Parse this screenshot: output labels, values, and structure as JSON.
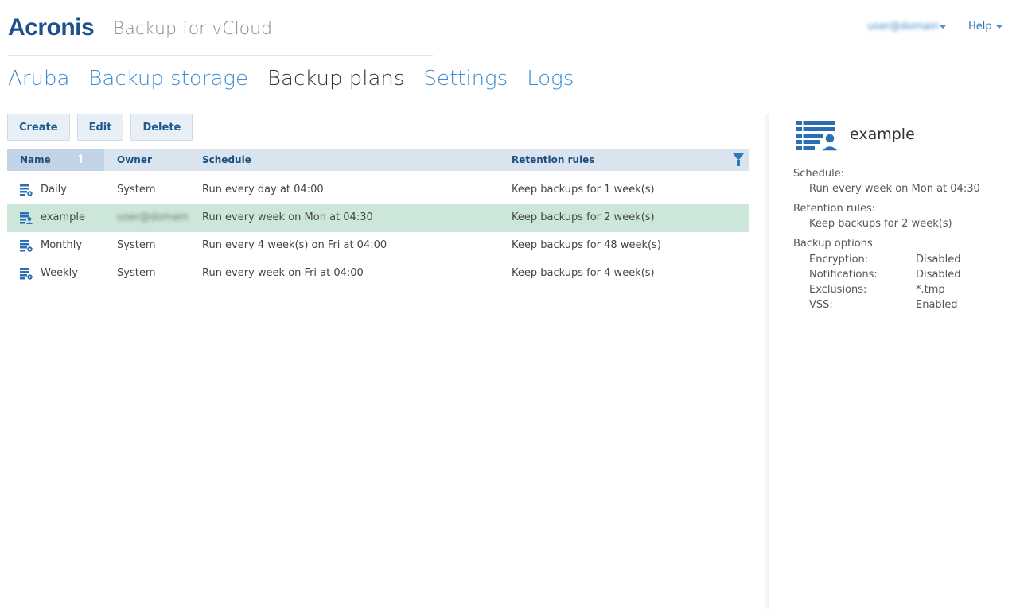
{
  "brand": {
    "logo": "Acronis",
    "product": "Backup for vCloud"
  },
  "header": {
    "user": "user@domain",
    "help": "Help"
  },
  "nav": {
    "items": [
      "Aruba",
      "Backup storage",
      "Backup plans",
      "Settings",
      "Logs"
    ],
    "active": "Backup plans"
  },
  "toolbar": {
    "create": "Create",
    "edit": "Edit",
    "delete": "Delete"
  },
  "grid": {
    "columns": {
      "name": "Name",
      "owner": "Owner",
      "schedule": "Schedule",
      "retention": "Retention rules"
    },
    "rows": [
      {
        "name": "Daily",
        "owner": "System",
        "schedule": "Run every day at 04:00",
        "retention": "Keep backups for 1 week(s)"
      },
      {
        "name": "example",
        "owner": "user@domain",
        "schedule": "Run every week on Mon at 04:30",
        "retention": "Keep backups for 2 week(s)"
      },
      {
        "name": "Monthly",
        "owner": "System",
        "schedule": "Run every 4 week(s) on Fri at 04:00",
        "retention": "Keep backups for 48 week(s)"
      },
      {
        "name": "Weekly",
        "owner": "System",
        "schedule": "Run every week on Fri at 04:00",
        "retention": "Keep backups for 4 week(s)"
      }
    ]
  },
  "detail": {
    "title": "example",
    "schedule_label": "Schedule:",
    "schedule_value": "Run every week on Mon at 04:30",
    "retention_label": "Retention rules:",
    "retention_value": "Keep backups for 2 week(s)",
    "options_label": "Backup options",
    "options": [
      {
        "key": "Encryption:",
        "value": "Disabled"
      },
      {
        "key": "Notifications:",
        "value": "Disabled"
      },
      {
        "key": "Exclusions:",
        "value": "*.tmp"
      },
      {
        "key": "VSS:",
        "value": "Enabled"
      }
    ]
  },
  "colors": {
    "accent": "#3d8cd0",
    "selected_row": "#cce6da",
    "header_bg": "#d9e4ef",
    "logo": "#1e4f8f"
  }
}
